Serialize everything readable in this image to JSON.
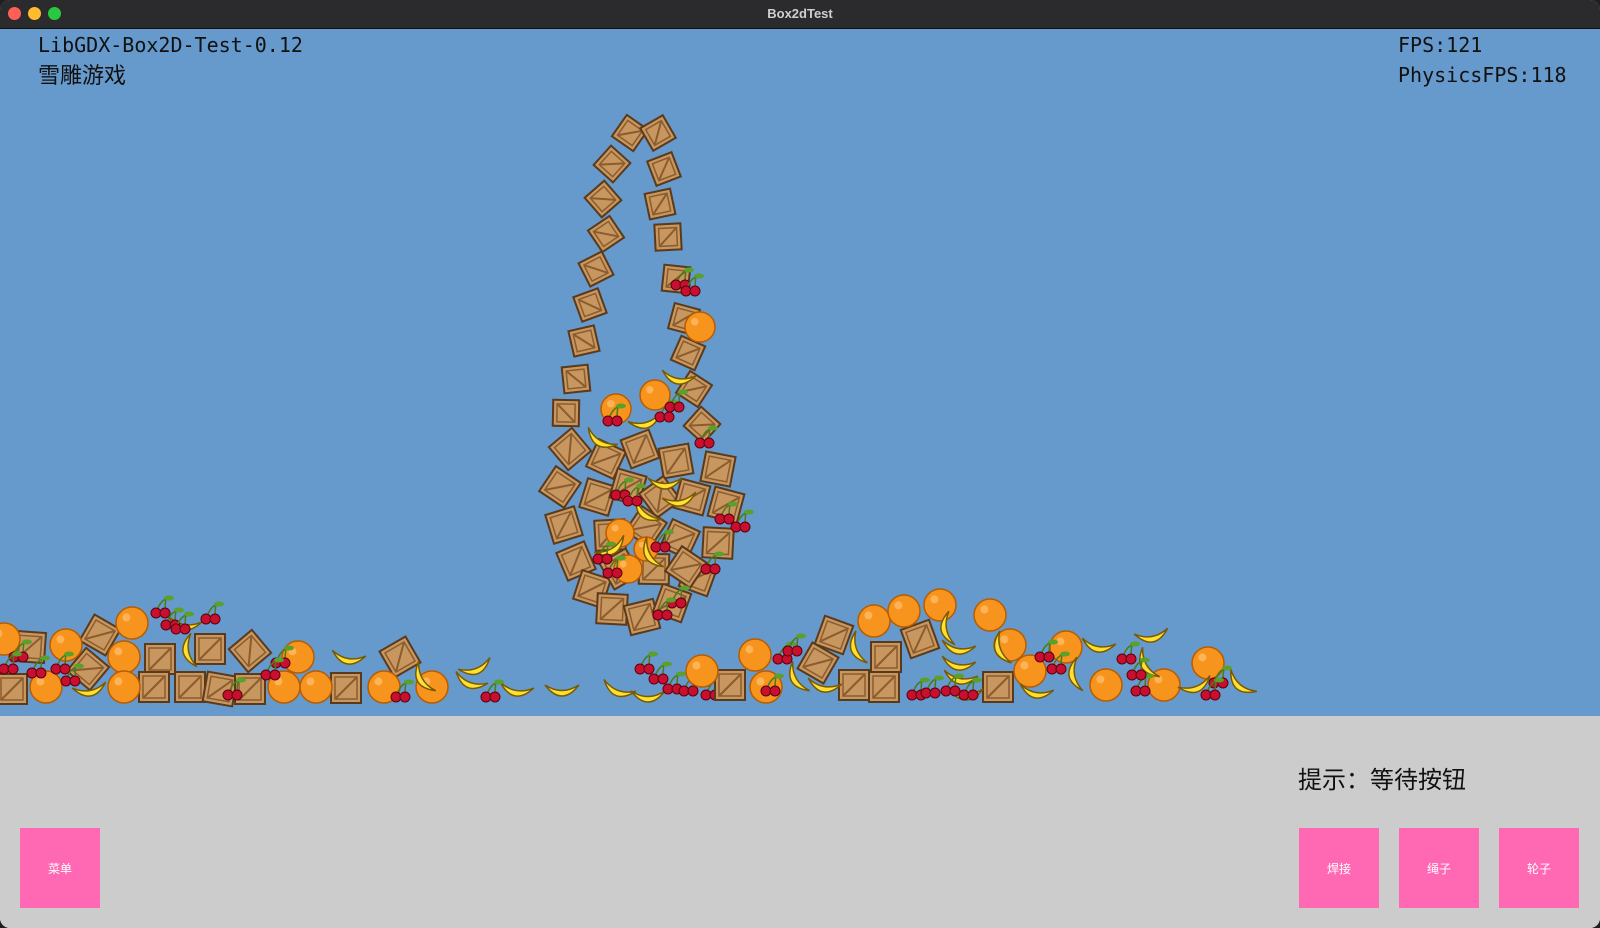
{
  "window": {
    "title": "Box2dTest"
  },
  "hud": {
    "version": "LibGDX-Box2D-Test-0.12",
    "subtitle": "雪雕游戏",
    "fps": "FPS:121",
    "physics_fps": "PhysicsFPS:118"
  },
  "panel": {
    "hint": "提示：等待按钮",
    "menu_button": "菜单",
    "weld_button": "焊接",
    "rope_button": "绳子",
    "wheel_button": "轮子"
  },
  "colors": {
    "sky": "#6699cc",
    "panel": "#cccccc",
    "button": "#ff69b4",
    "crate": "#c8965f",
    "orange": "#f7941d",
    "banana": "#ffe033",
    "cherry": "#c8102e"
  },
  "icons": [
    "close-icon",
    "minimize-icon",
    "maximize-icon",
    "crate-icon",
    "orange-icon",
    "banana-icon",
    "cherry-icon"
  ]
}
